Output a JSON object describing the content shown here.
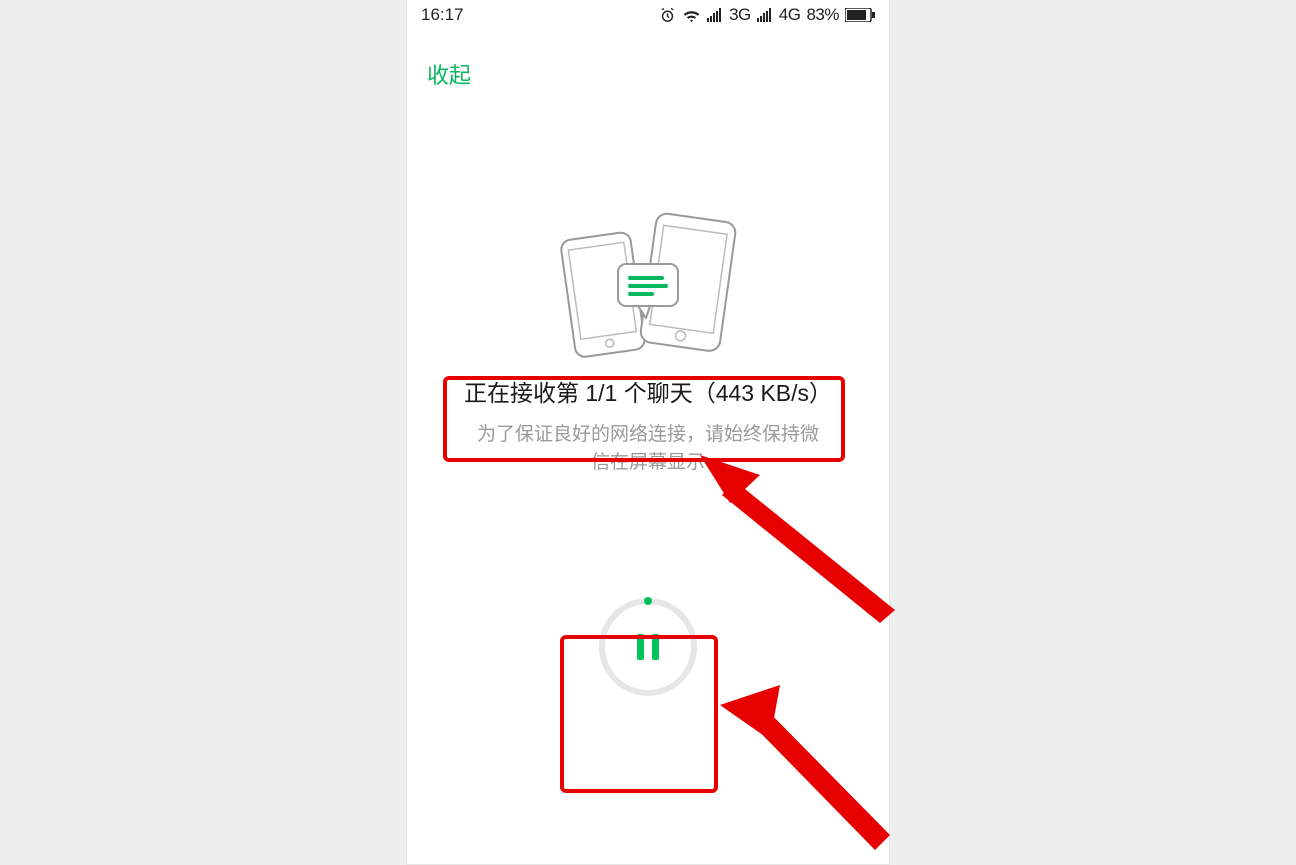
{
  "status_bar": {
    "time": "16:17",
    "network1": "3G",
    "network2": "4G",
    "battery_text": "83%"
  },
  "top": {
    "collapse_label": "收起"
  },
  "transfer": {
    "status_line": "正在接收第 1/1 个聊天（443 KB/s）",
    "hint_line1": "为了保证良好的网络连接，请始终保持微",
    "hint_line2": "信在屏幕显示"
  },
  "icons": {
    "alarm": "alarm-icon",
    "wifi": "wifi-icon",
    "signal": "signal-icon",
    "battery": "battery-icon",
    "pause": "pause-icon",
    "phones": "phones-transfer-icon"
  },
  "colors": {
    "accent_green": "#07b75d",
    "annotation_red": "#e60000",
    "text_gray": "#9a9a9a"
  }
}
